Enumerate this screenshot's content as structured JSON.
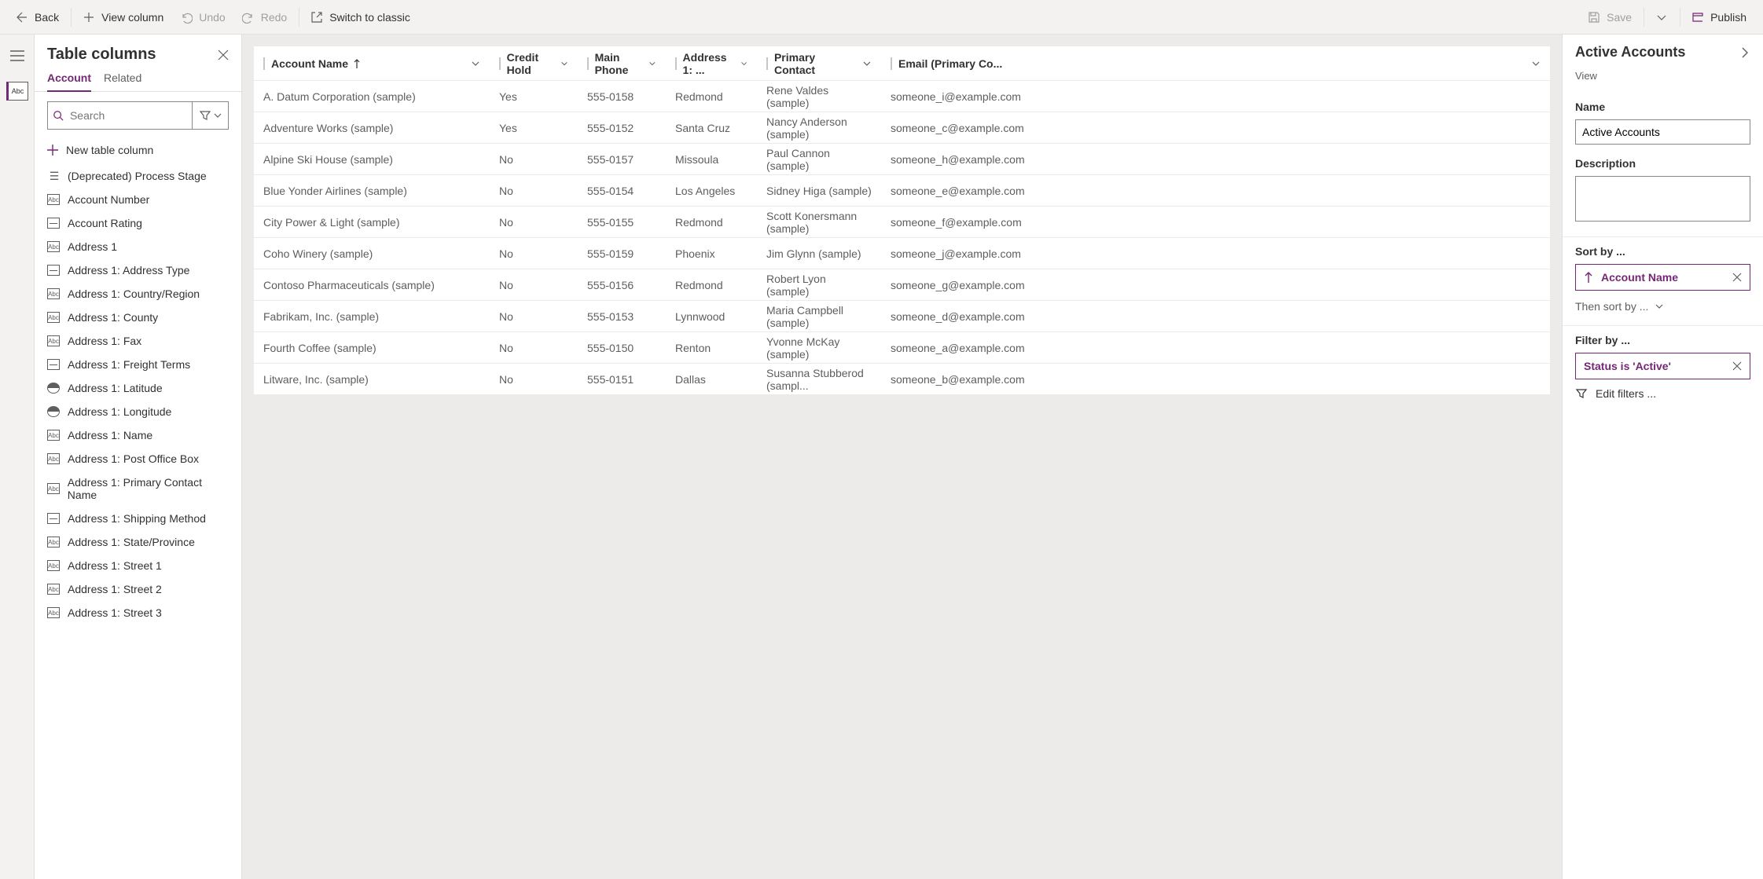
{
  "toolbar": {
    "back": "Back",
    "view_column": "View column",
    "undo": "Undo",
    "redo": "Redo",
    "switch": "Switch to classic",
    "save": "Save",
    "publish": "Publish"
  },
  "left": {
    "title": "Table columns",
    "tabs": [
      "Account",
      "Related"
    ],
    "search_placeholder": "Search",
    "new_col": "New table column",
    "items": [
      {
        "icon": "list",
        "label": "(Deprecated) Process Stage"
      },
      {
        "icon": "abc",
        "label": "Account Number"
      },
      {
        "icon": "opt",
        "label": "Account Rating"
      },
      {
        "icon": "abc",
        "label": "Address 1"
      },
      {
        "icon": "opt",
        "label": "Address 1: Address Type"
      },
      {
        "icon": "abc",
        "label": "Address 1: Country/Region"
      },
      {
        "icon": "abc",
        "label": "Address 1: County"
      },
      {
        "icon": "abc",
        "label": "Address 1: Fax"
      },
      {
        "icon": "opt",
        "label": "Address 1: Freight Terms"
      },
      {
        "icon": "globe",
        "label": "Address 1: Latitude"
      },
      {
        "icon": "globe",
        "label": "Address 1: Longitude"
      },
      {
        "icon": "abc",
        "label": "Address 1: Name"
      },
      {
        "icon": "abc",
        "label": "Address 1: Post Office Box"
      },
      {
        "icon": "abc",
        "label": "Address 1: Primary Contact Name"
      },
      {
        "icon": "opt",
        "label": "Address 1: Shipping Method"
      },
      {
        "icon": "abc",
        "label": "Address 1: State/Province"
      },
      {
        "icon": "abc",
        "label": "Address 1: Street 1"
      },
      {
        "icon": "abc",
        "label": "Address 1: Street 2"
      },
      {
        "icon": "abc",
        "label": "Address 1: Street 3"
      }
    ]
  },
  "grid": {
    "columns": [
      "Account Name",
      "Credit Hold",
      "Main Phone",
      "Address 1: ...",
      "Primary Contact",
      "Email (Primary Co..."
    ],
    "rows": [
      [
        "A. Datum Corporation (sample)",
        "Yes",
        "555-0158",
        "Redmond",
        "Rene Valdes (sample)",
        "someone_i@example.com"
      ],
      [
        "Adventure Works (sample)",
        "Yes",
        "555-0152",
        "Santa Cruz",
        "Nancy Anderson (sample)",
        "someone_c@example.com"
      ],
      [
        "Alpine Ski House (sample)",
        "No",
        "555-0157",
        "Missoula",
        "Paul Cannon (sample)",
        "someone_h@example.com"
      ],
      [
        "Blue Yonder Airlines (sample)",
        "No",
        "555-0154",
        "Los Angeles",
        "Sidney Higa (sample)",
        "someone_e@example.com"
      ],
      [
        "City Power & Light (sample)",
        "No",
        "555-0155",
        "Redmond",
        "Scott Konersmann (sample)",
        "someone_f@example.com"
      ],
      [
        "Coho Winery (sample)",
        "No",
        "555-0159",
        "Phoenix",
        "Jim Glynn (sample)",
        "someone_j@example.com"
      ],
      [
        "Contoso Pharmaceuticals (sample)",
        "No",
        "555-0156",
        "Redmond",
        "Robert Lyon (sample)",
        "someone_g@example.com"
      ],
      [
        "Fabrikam, Inc. (sample)",
        "No",
        "555-0153",
        "Lynnwood",
        "Maria Campbell (sample)",
        "someone_d@example.com"
      ],
      [
        "Fourth Coffee (sample)",
        "No",
        "555-0150",
        "Renton",
        "Yvonne McKay (sample)",
        "someone_a@example.com"
      ],
      [
        "Litware, Inc. (sample)",
        "No",
        "555-0151",
        "Dallas",
        "Susanna Stubberod (sampl...",
        "someone_b@example.com"
      ]
    ]
  },
  "right": {
    "title": "Active Accounts",
    "subtitle": "View",
    "name_label": "Name",
    "name_value": "Active Accounts",
    "desc_label": "Description",
    "desc_value": "",
    "sort_by_label": "Sort by ...",
    "sort_field": "Account Name",
    "then_sort": "Then sort by ...",
    "filter_by_label": "Filter by ...",
    "filter_pill": "Status is 'Active'",
    "edit_filters": "Edit filters ..."
  }
}
